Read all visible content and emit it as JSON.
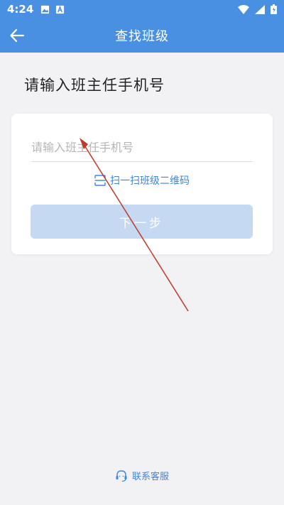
{
  "status_bar": {
    "time": "4:24",
    "icons": [
      "image-icon",
      "a-notification-icon",
      "wifi-icon",
      "signal-icon",
      "battery-icon"
    ]
  },
  "app_bar": {
    "title": "查找班级",
    "back_icon": "arrow-left-icon"
  },
  "page": {
    "heading": "请输入班主任手机号"
  },
  "form": {
    "phone_placeholder": "请输入班主任手机号",
    "phone_value": "",
    "scan_label": "扫一扫班级二维码",
    "scan_icon": "scan-icon",
    "next_label": "下一步"
  },
  "footer": {
    "support_label": "联系客服",
    "support_icon": "headset-icon"
  },
  "colors": {
    "primary": "#4a90e2",
    "link": "#3d86d8",
    "button_disabled": "#c5d9f2",
    "background": "#f2f2f4",
    "annotation_arrow": "#c0392b"
  }
}
